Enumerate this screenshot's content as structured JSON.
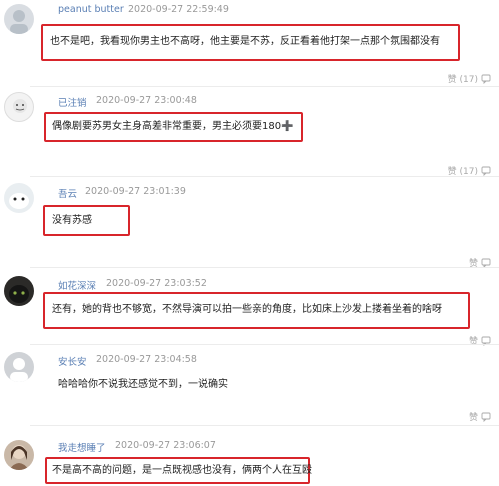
{
  "comments": [
    {
      "username": "peanut butter",
      "time": "2020-09-27 22:59:49",
      "text": "也不是吧，我看现你男主也不高呀，他主要是不苏，反正看着他打架一点那个氛围都没有",
      "likes": "赞 (17)",
      "highlighted": true
    },
    {
      "username": "已注销",
      "time": "2020-09-27 23:00:48",
      "text": "偶像剧要苏男女主身高差非常重要，男主必须要180➕",
      "likes": "赞 (17)",
      "highlighted": true
    },
    {
      "username": "吾云",
      "time": "2020-09-27 23:01:39",
      "text": "没有苏感",
      "likes": "赞",
      "highlighted": true
    },
    {
      "username": "如花深深",
      "time": "2020-09-27 23:03:52",
      "text": "还有，她的背也不够宽，不然导演可以拍一些亲的角度，比如床上沙发上搂着坐着的啥呀",
      "likes": "赞",
      "highlighted": true
    },
    {
      "username": "安长安",
      "time": "2020-09-27 23:04:58",
      "text": "哈哈哈你不说我还感觉不到，一说确实",
      "likes": "赞",
      "highlighted": false
    },
    {
      "username": "我走想睡了",
      "time": "2020-09-27 23:06:07",
      "text": "不是高不高的问题，是一点既视感也没有，俩两个人在互殴",
      "likes": "赞",
      "highlighted": true
    }
  ]
}
